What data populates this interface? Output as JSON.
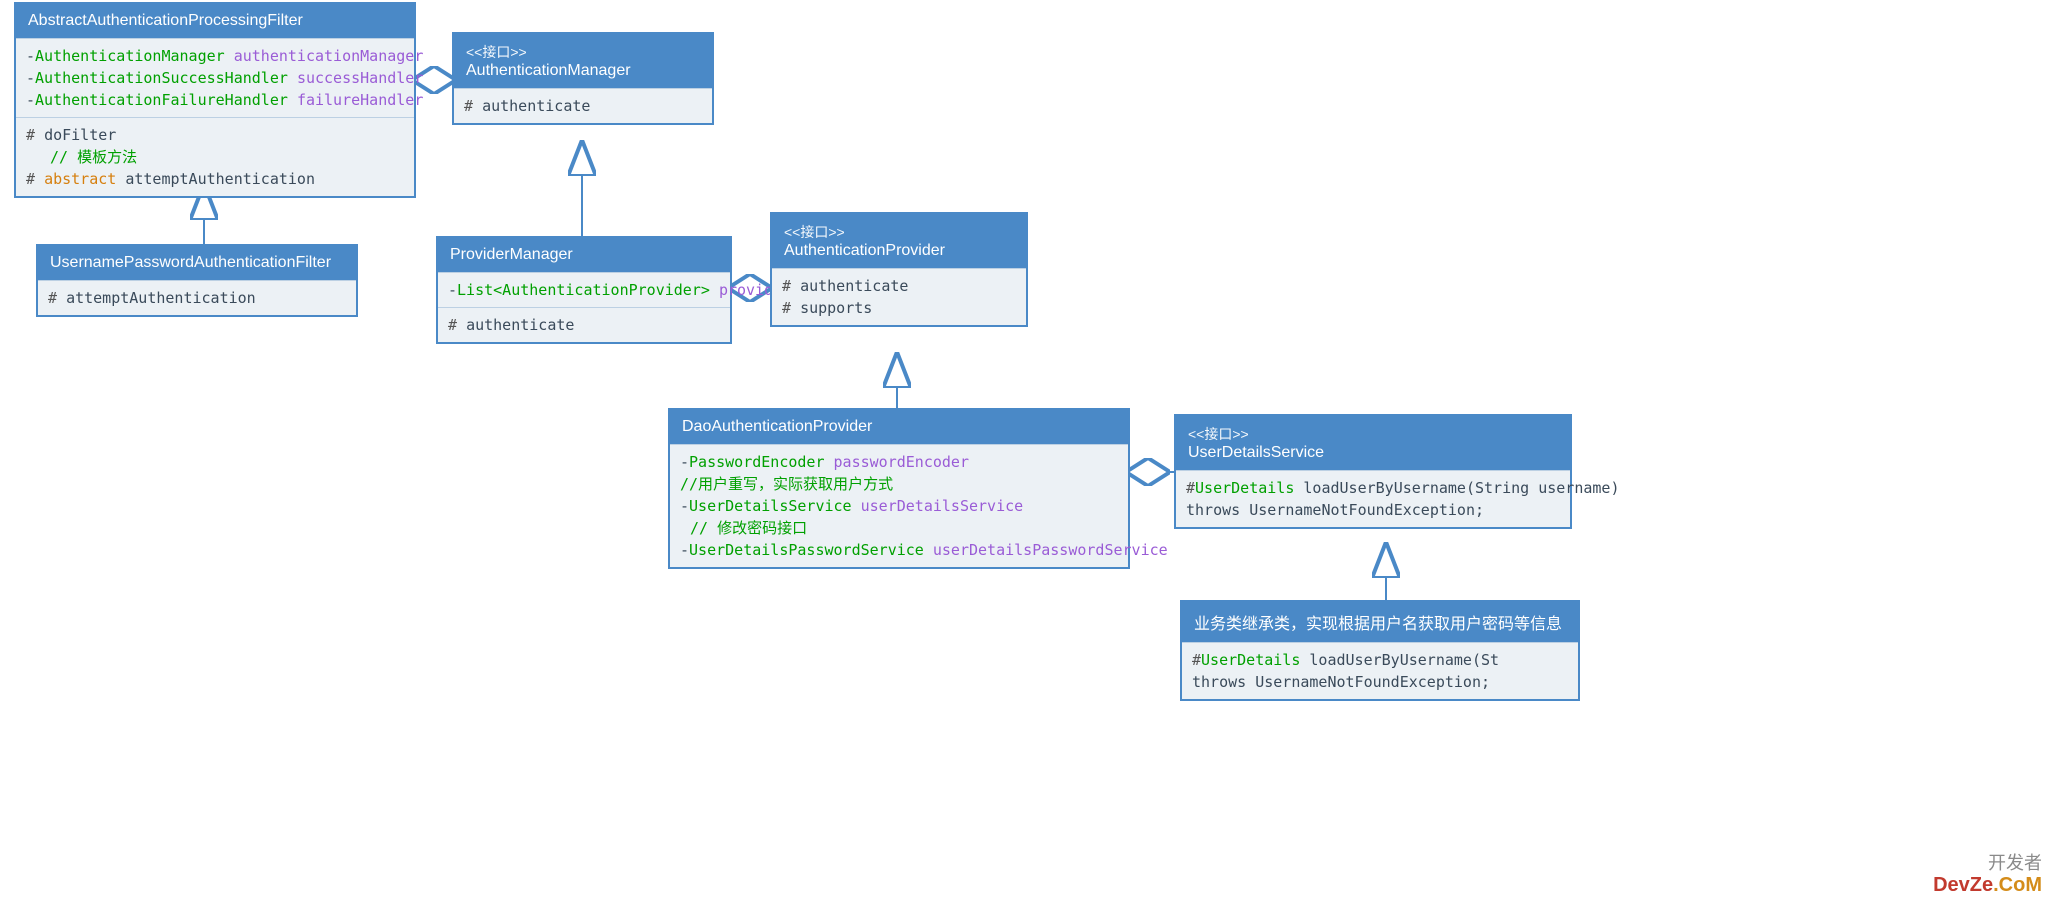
{
  "colors": {
    "header": "#4a89c7",
    "section": "#ecf1f5",
    "type": "#00a000",
    "name": "#9a5cd6",
    "keyword": "#d67f0e"
  },
  "watermark": {
    "line1": "开发者",
    "line2a": "DevZe",
    "line2b": ".CoM"
  },
  "boxes": {
    "aapf": {
      "title": "AbstractAuthenticationProcessingFilter",
      "attrs": [
        {
          "vis": "-",
          "type": "AuthenticationManager",
          "name": "authenticationManager"
        },
        {
          "vis": "-",
          "type": "AuthenticationSuccessHandler",
          "name": "successHandler"
        },
        {
          "vis": "-",
          "type": "AuthenticationFailureHandler",
          "name": "failureHandler"
        }
      ],
      "ops": [
        {
          "vis": "#",
          "text": "doFilter",
          "comment": "// 模板方法"
        },
        {
          "vis": "#",
          "kw": "abstract",
          "text": "attemptAuthentication"
        }
      ]
    },
    "upaf": {
      "title": "UsernamePasswordAuthenticationFilter",
      "ops": [
        {
          "vis": "#",
          "text": "attemptAuthentication"
        }
      ]
    },
    "am": {
      "stereo": "<<接口>>",
      "title": "AuthenticationManager",
      "ops": [
        {
          "vis": "#",
          "text": "authenticate"
        }
      ]
    },
    "pm": {
      "title": "ProviderManager",
      "attrs": [
        {
          "vis": "-",
          "type": "List<AuthenticationProvider>",
          "name": "providers"
        }
      ],
      "ops": [
        {
          "vis": "#",
          "text": "authenticate"
        }
      ]
    },
    "ap": {
      "stereo": "<<接口>>",
      "title": "AuthenticationProvider",
      "ops": [
        {
          "vis": "#",
          "text": "authenticate"
        },
        {
          "vis": "#",
          "text": "supports"
        }
      ]
    },
    "dap": {
      "title": "DaoAuthenticationProvider",
      "attrs": [
        {
          "vis": "-",
          "type": "PasswordEncoder",
          "name": "passwordEncoder"
        },
        {
          "comment": "//用户重写，实际获取用户方式"
        },
        {
          "vis": "-",
          "type": "UserDetailsService",
          "name": "userDetailsService"
        },
        {
          "comment": "// 修改密码接口"
        },
        {
          "vis": "-",
          "type": "UserDetailsPasswordService",
          "name": "userDetailsPasswordService"
        }
      ]
    },
    "uds": {
      "stereo": "<<接口>>",
      "title": "UserDetailsService",
      "ops": [
        {
          "vis": "#",
          "type": "UserDetails",
          "text": "loadUserByUsername(String username)"
        },
        {
          "plain": "throws UsernameNotFoundException;"
        }
      ]
    },
    "biz": {
      "title": "业务类继承类，实现根据用户名获取用户密码等信息",
      "ops": [
        {
          "vis": "#",
          "type": "UserDetails",
          "text": "loadUserByUsername(St"
        },
        {
          "plain": "throws UsernameNotFoundException;"
        }
      ]
    }
  }
}
